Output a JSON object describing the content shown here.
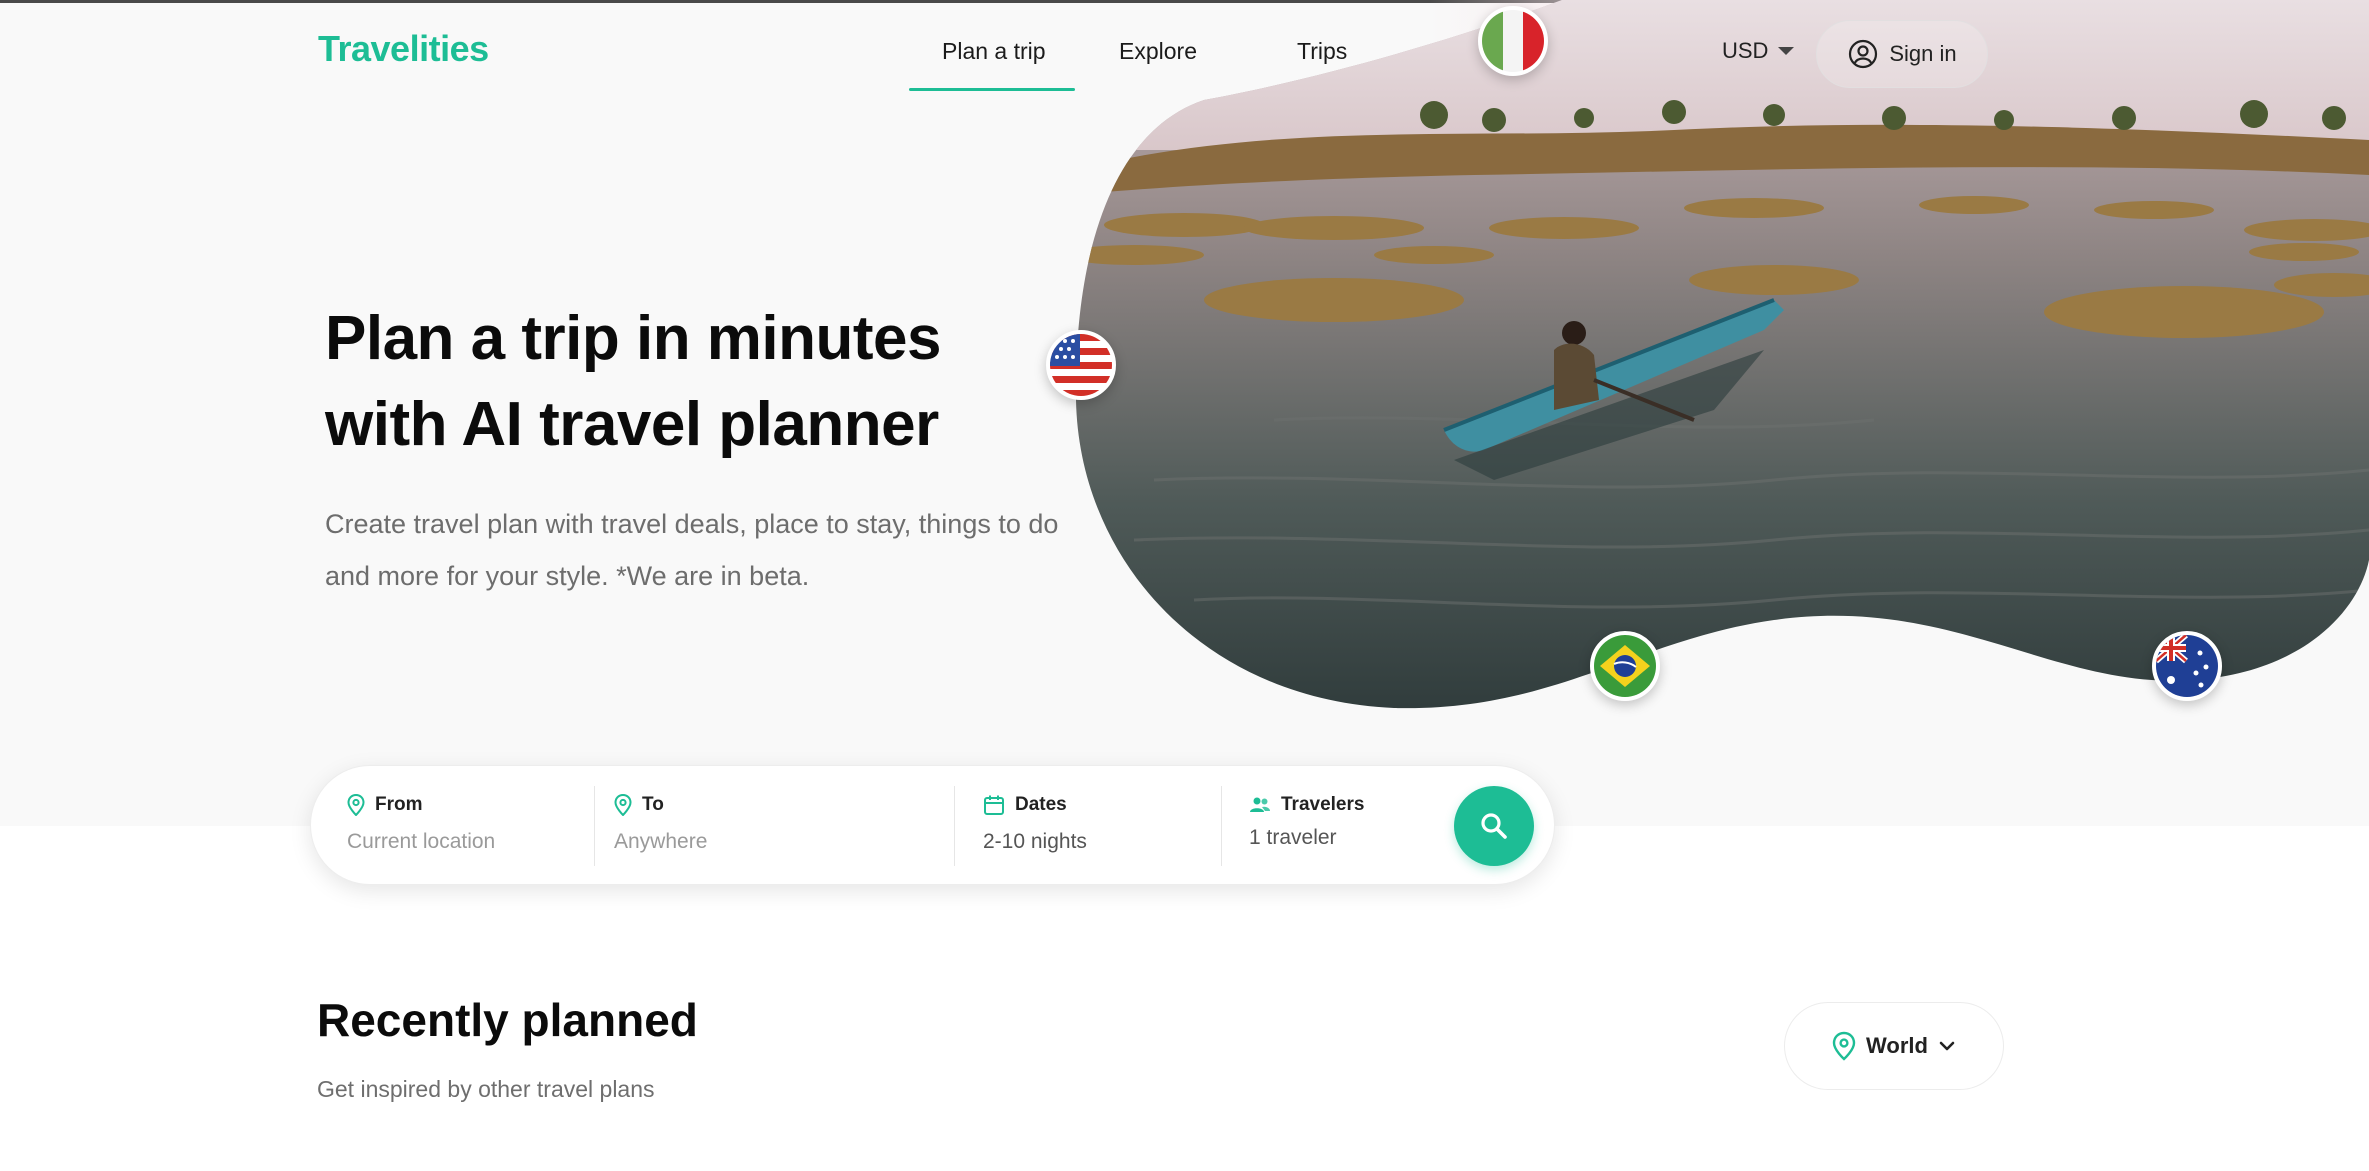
{
  "brand": {
    "name": "Travelities",
    "accent": "#1dbd95"
  },
  "nav": {
    "items": [
      {
        "label": "Plan a trip",
        "active": true
      },
      {
        "label": "Explore",
        "active": false
      },
      {
        "label": "Trips",
        "active": false
      }
    ]
  },
  "header": {
    "currency": "USD",
    "signin_label": "Sign in"
  },
  "hero": {
    "title_line1": "Plan a trip in minutes",
    "title_line2": "with AI travel planner",
    "subtitle": "Create travel plan with travel deals, place to stay, things to do and more for your style. *We are in beta.",
    "flags": [
      "italy-flag-icon",
      "usa-flag-icon",
      "brazil-flag-icon",
      "australia-flag-icon"
    ]
  },
  "search": {
    "from": {
      "label": "From",
      "placeholder": "Current location"
    },
    "to": {
      "label": "To",
      "placeholder": "Anywhere"
    },
    "dates": {
      "label": "Dates",
      "value": "2-10 nights"
    },
    "travelers": {
      "label": "Travelers",
      "value": "1 traveler"
    }
  },
  "recent": {
    "title": "Recently planned",
    "subtitle": "Get inspired by other travel plans",
    "region_filter": "World"
  }
}
